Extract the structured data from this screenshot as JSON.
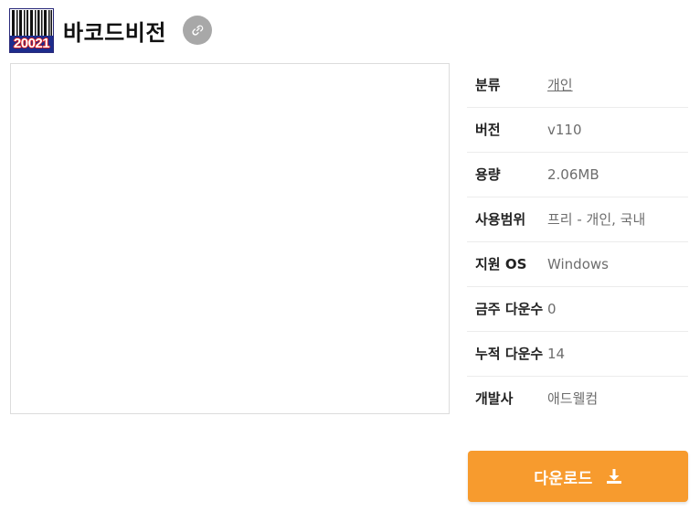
{
  "app": {
    "title": "바코드비전",
    "icon_text": "20021",
    "icon_name": "barcode-app-icon"
  },
  "info": {
    "rows": [
      {
        "key": "분류",
        "value": "개인"
      },
      {
        "key": "버전",
        "value": "v110"
      },
      {
        "key": "용량",
        "value": "2.06MB"
      },
      {
        "key": "사용범위",
        "value": "프리 - 개인, 국내"
      },
      {
        "key": "지원 OS",
        "value": "Windows"
      },
      {
        "key": "금주 다운수",
        "value": "0"
      },
      {
        "key": "누적 다운수",
        "value": "14"
      },
      {
        "key": "개발사",
        "value": "애드웰컴"
      }
    ]
  },
  "download": {
    "label": "다운로드",
    "icon": "download-icon"
  },
  "colors": {
    "accent": "#f79b2e",
    "link_button": "#a8a8a8"
  }
}
